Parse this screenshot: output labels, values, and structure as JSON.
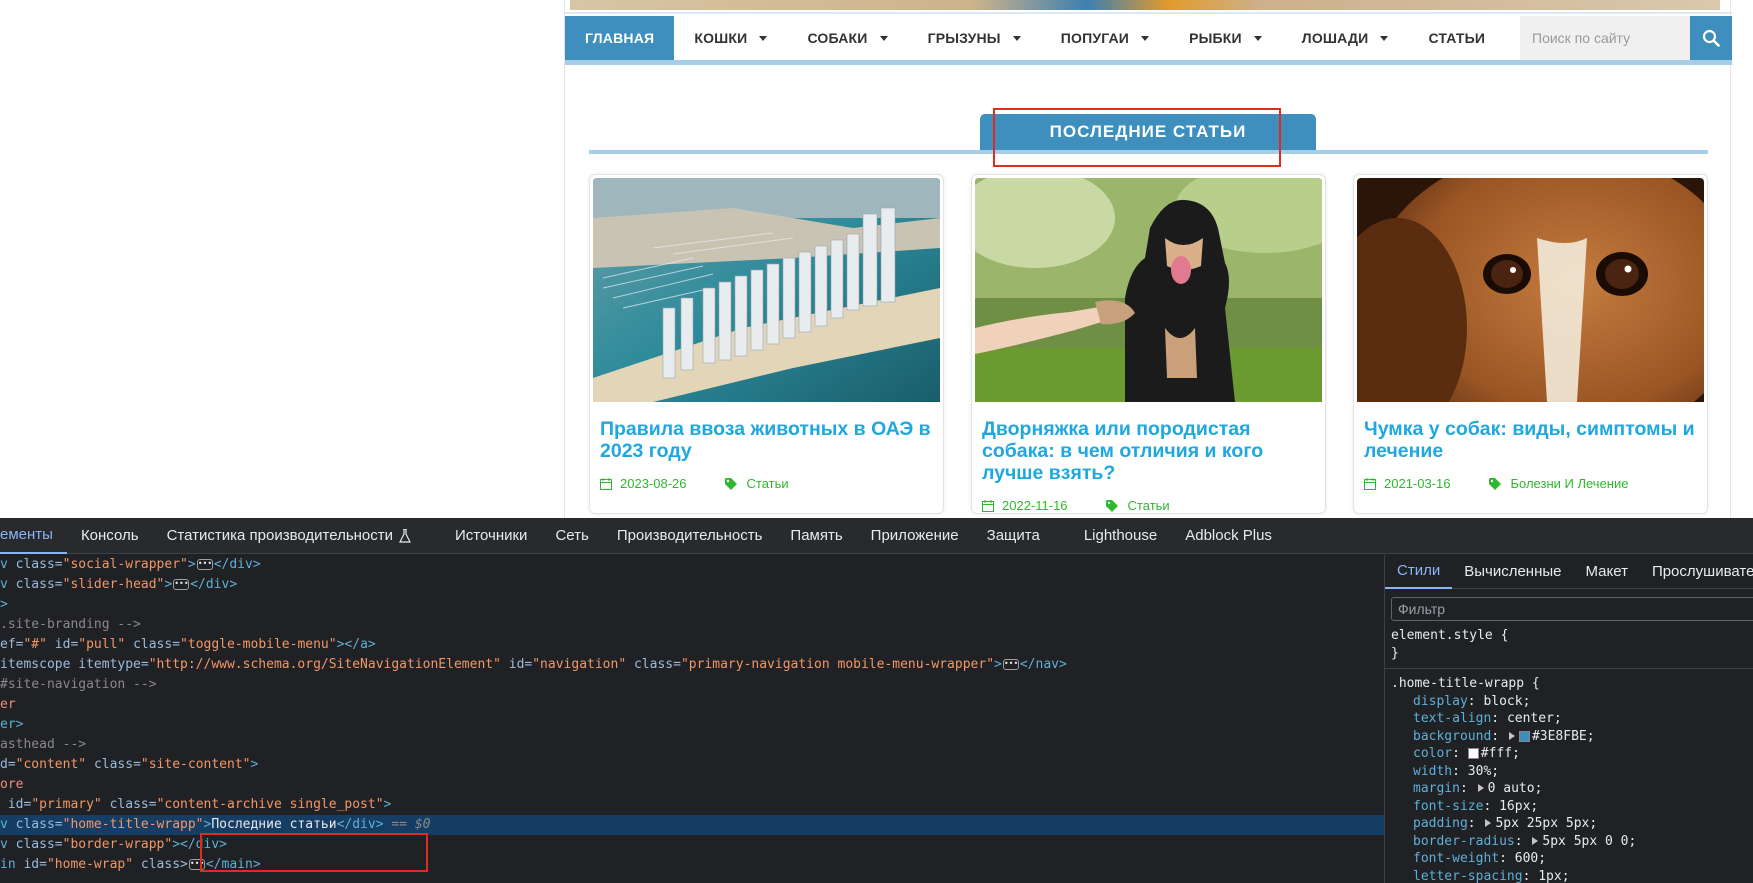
{
  "nav": {
    "items": [
      {
        "label": "ГЛАВНАЯ",
        "active": true,
        "dropdown": false
      },
      {
        "label": "КОШКИ",
        "dropdown": true
      },
      {
        "label": "СОБАКИ",
        "dropdown": true
      },
      {
        "label": "ГРЫЗУНЫ",
        "dropdown": true
      },
      {
        "label": "ПОПУГАИ",
        "dropdown": true
      },
      {
        "label": "РЫБКИ",
        "dropdown": true
      },
      {
        "label": "ЛОШАДИ",
        "dropdown": true
      },
      {
        "label": "СТАТЬИ",
        "dropdown": false
      }
    ],
    "search_placeholder": "Поиск по сайту",
    "search_icon": "search-icon"
  },
  "section": {
    "title": "ПОСЛЕДНИЕ СТАТЬИ"
  },
  "cards": [
    {
      "title": "Правила ввоза животных в ОАЭ в 2023 году",
      "date": "2023-08-26",
      "category": "Статьи",
      "image": "aerial-city-marina"
    },
    {
      "title": "Дворняжка или породистая собака: в чем отличия и кого лучше взять?",
      "date": "2022-11-16",
      "category": "Статьи",
      "image": "black-dog-paw"
    },
    {
      "title": "Чумка у собак: виды, симптомы и лечение",
      "date": "2021-03-16",
      "category": "Болезни И Лечение",
      "image": "beagle-closeup"
    }
  ],
  "devtools": {
    "tabs": [
      "ементы",
      "Консоль",
      "Статистика производительности",
      "Источники",
      "Сеть",
      "Производительность",
      "Память",
      "Приложение",
      "Защита",
      "Lighthouse",
      "Adblock Plus"
    ],
    "dom": {
      "l1_pre": "v ",
      "l1_attr": "class",
      "l1_val": "\"social-wrapper\"",
      "l1_close": "</div>",
      "l2_pre": "v ",
      "l2_attr": "class",
      "l2_val": "\"slider-head\"",
      "l2_close": "</div>",
      "l3": ">",
      "l4": ".site-branding -->",
      "l5_a": "ef=",
      "l5_av": "\"#\"",
      "l5_b": "id=",
      "l5_bv": "\"pull\"",
      "l5_c": "class=",
      "l5_cv": "\"toggle-mobile-menu\"",
      "l5_end": "></a>",
      "l6_a": "itemscope itemtype=",
      "l6_av": "\"http://www.schema.org/SiteNavigationElement\"",
      "l6_b": "id=",
      "l6_bv": "\"navigation\"",
      "l6_c": "class=",
      "l6_cv": "\"primary-navigation mobile-menu-wrapper\"",
      "l6_end": "</nav>",
      "l7": "#site-navigation -->",
      "l8": "er",
      "l9": "er>",
      "l10": "asthead -->",
      "l11_a": "d=",
      "l11_av": "\"content\"",
      "l11_b": "class=",
      "l11_bv": "\"site-content\"",
      "l11_end": ">",
      "l12": "ore",
      "l13_a": "id=",
      "l13_av": "\"primary\"",
      "l13_b": "class=",
      "l13_bv": "\"content-archive single_post\"",
      "l13_end": ">",
      "l14_pre": "v ",
      "l14_attr": "class=",
      "l14_val": "\"home-title-wrapp\"",
      "l14_text": "Последние статьи",
      "l14_close": "</div>",
      "l14_eq": " == ",
      "l14_dollar": "$0",
      "l15_pre": "v ",
      "l15_attr": "class=",
      "l15_val": "\"border-wrapp\"",
      "l15_close": "></div>",
      "l16_pre": "in ",
      "l16_a": "id=",
      "l16_av": "\"home-wrap\"",
      "l16_b": "class>",
      "l16_close": "</main>"
    },
    "styles": {
      "tabs": [
        "Стили",
        "Вычисленные",
        "Макет",
        "Прослушивате"
      ],
      "filter_placeholder": "Фильтр",
      "element_style": "element.style {",
      "element_close": "}",
      "rule_selector": ".home-title-wrapp {",
      "props": [
        {
          "name": "display",
          "value": "block;"
        },
        {
          "name": "text-align",
          "value": "center;"
        },
        {
          "name": "background",
          "value": "#3E8FBE;",
          "arrow": true,
          "swatch": "#3E8FBE"
        },
        {
          "name": "color",
          "value": "#fff;",
          "swatch": "#ffffff"
        },
        {
          "name": "width",
          "value": "30%;"
        },
        {
          "name": "margin",
          "value": "0 auto;",
          "arrow": true
        },
        {
          "name": "font-size",
          "value": "16px;"
        },
        {
          "name": "padding",
          "value": "5px 25px 5px;",
          "arrow": true
        },
        {
          "name": "border-radius",
          "value": "5px 5px 0 0;",
          "arrow": true
        },
        {
          "name": "font-weight",
          "value": "600;"
        },
        {
          "name": "letter-spacing",
          "value": "1px;"
        }
      ]
    }
  },
  "colors": {
    "accent": "#3e8fbe",
    "link": "#1fa8e0",
    "meta_green": "#2eb82e",
    "highlight": "#e32b1d"
  }
}
